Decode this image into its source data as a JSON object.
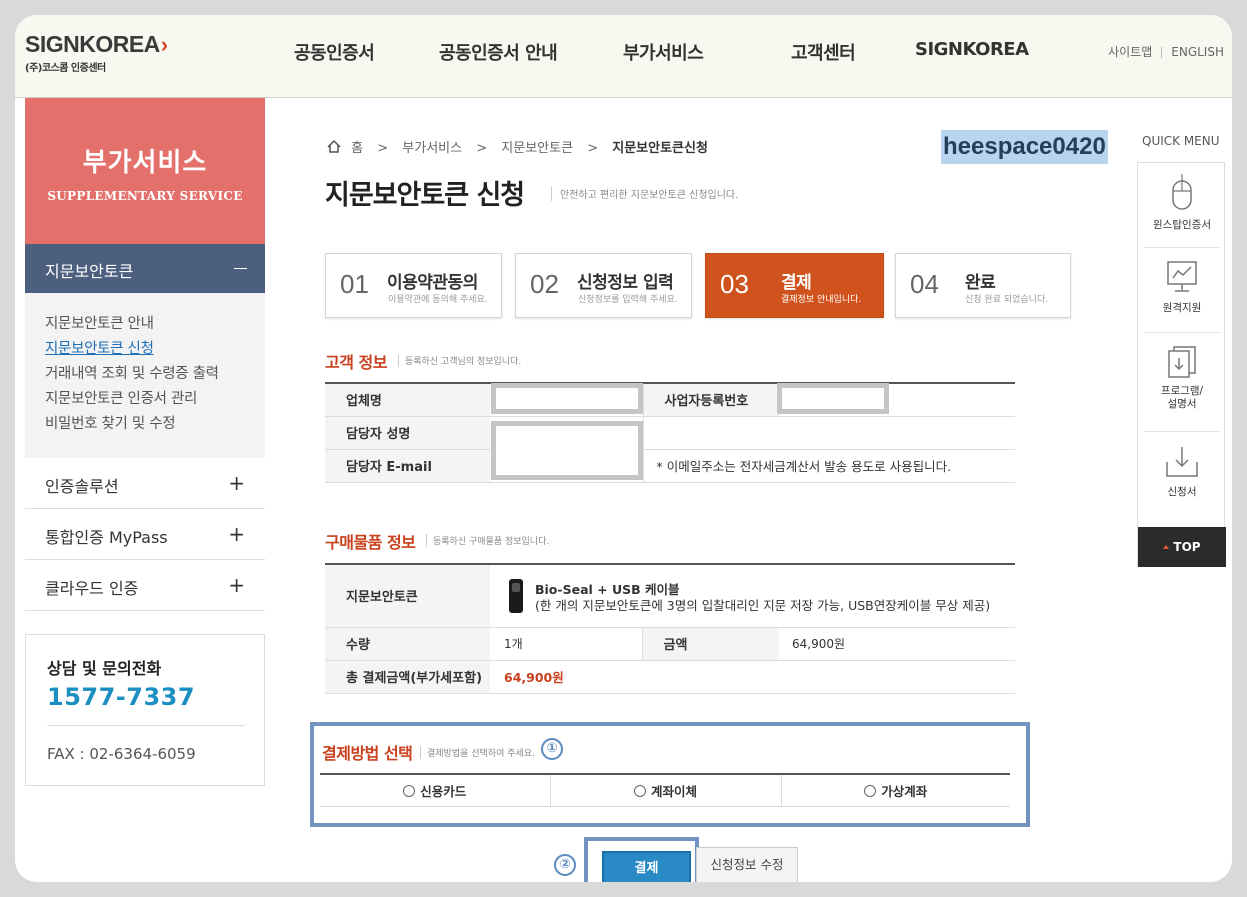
{
  "header": {
    "logo_text": "SIGNKOREA",
    "logo_sub": "(주)코스콤 인증센터",
    "nav": [
      "공동인증서",
      "공동인증서 안내",
      "부가서비스",
      "고객센터",
      "SIGNKOREA"
    ],
    "util": [
      "사이트맵",
      "ENGLISH"
    ]
  },
  "sidebar": {
    "title": "부가서비스",
    "subtitle": "SUPPLEMENTARY SERVICE",
    "active_menu": "지문보안토큰",
    "subitems": [
      "지문보안토큰 안내",
      "지문보안토큰 신청",
      "거래내역 조회 및 수령증 출력",
      "지문보안토큰 인증서 관리",
      "비밀번호 찾기 및 수정"
    ],
    "current_subitem_index": 1,
    "menus": [
      "인증솔루션",
      "통합인증 MyPass",
      "클라우드 인증"
    ],
    "contact_title": "상담 및 문의전화",
    "contact_tel": "1577-7337",
    "fax": "FAX : 02-6364-6059"
  },
  "breadcrumb": [
    "홈",
    "부가서비스",
    "지문보안토큰",
    "지문보안토큰신청"
  ],
  "user_id": "heespace0420",
  "page": {
    "title": "지문보안토큰 신청",
    "desc": "안전하고 편리한 지문보안토큰 신청입니다."
  },
  "steps": [
    {
      "num": "01",
      "label": "이용약관동의",
      "sub": "이용약관에 동의해 주세요."
    },
    {
      "num": "02",
      "label": "신청정보 입력",
      "sub": "신청정보를 입력해 주세요."
    },
    {
      "num": "03",
      "label": "결제",
      "sub": "결제정보 안내입니다."
    },
    {
      "num": "04",
      "label": "완료",
      "sub": "신청 완료 되었습니다."
    }
  ],
  "customer": {
    "title": "고객 정보",
    "desc": "등록하신 고객님의 정보입니다.",
    "company_label": "업체명",
    "bizno_label": "사업자등록번호",
    "manager_label": "담당자 성명",
    "email_label": "담당자 E-mail",
    "email_note": "* 이메일주소는 전자세금계산서 발송 용도로 사용됩니다."
  },
  "purchase": {
    "title": "구매물품 정보",
    "desc": "등록하신 구매물품 정보입니다.",
    "product_label": "지문보안토큰",
    "product_name": "Bio-Seal + USB 케이블",
    "product_desc": "(한 개의 지문보안토큰에 3명의 입찰대리인 지문 저장 가능, USB연장케이블 무상 제공)",
    "qty_label": "수량",
    "qty": "1개",
    "amount_label": "금액",
    "amount": "64,900원",
    "total_label": "총 결제금액(부가세포함)",
    "total": "64,900원"
  },
  "payment": {
    "title": "결제방법 선택",
    "desc": "결제방법을 선택하여 주세요.",
    "marker": "①",
    "options": [
      "신용카드",
      "계좌이체",
      "가상계좌"
    ]
  },
  "buttons": {
    "marker": "②",
    "pay": "결제",
    "edit": "신청정보 수정"
  },
  "quick_menu": {
    "label": "QUICK MENU",
    "items": [
      "윈스탑인증서",
      "원격지원",
      "프로그램/\n설명서",
      "신청서"
    ],
    "top": "TOP"
  },
  "colors": {
    "accent_red": "#c9411d",
    "step_active": "#d0531e",
    "sidebar_top": "#e4706b",
    "sidebar_active": "#4c5f7f",
    "tel_blue": "#1b8fc2",
    "annotation_blue": "#7293bf"
  }
}
